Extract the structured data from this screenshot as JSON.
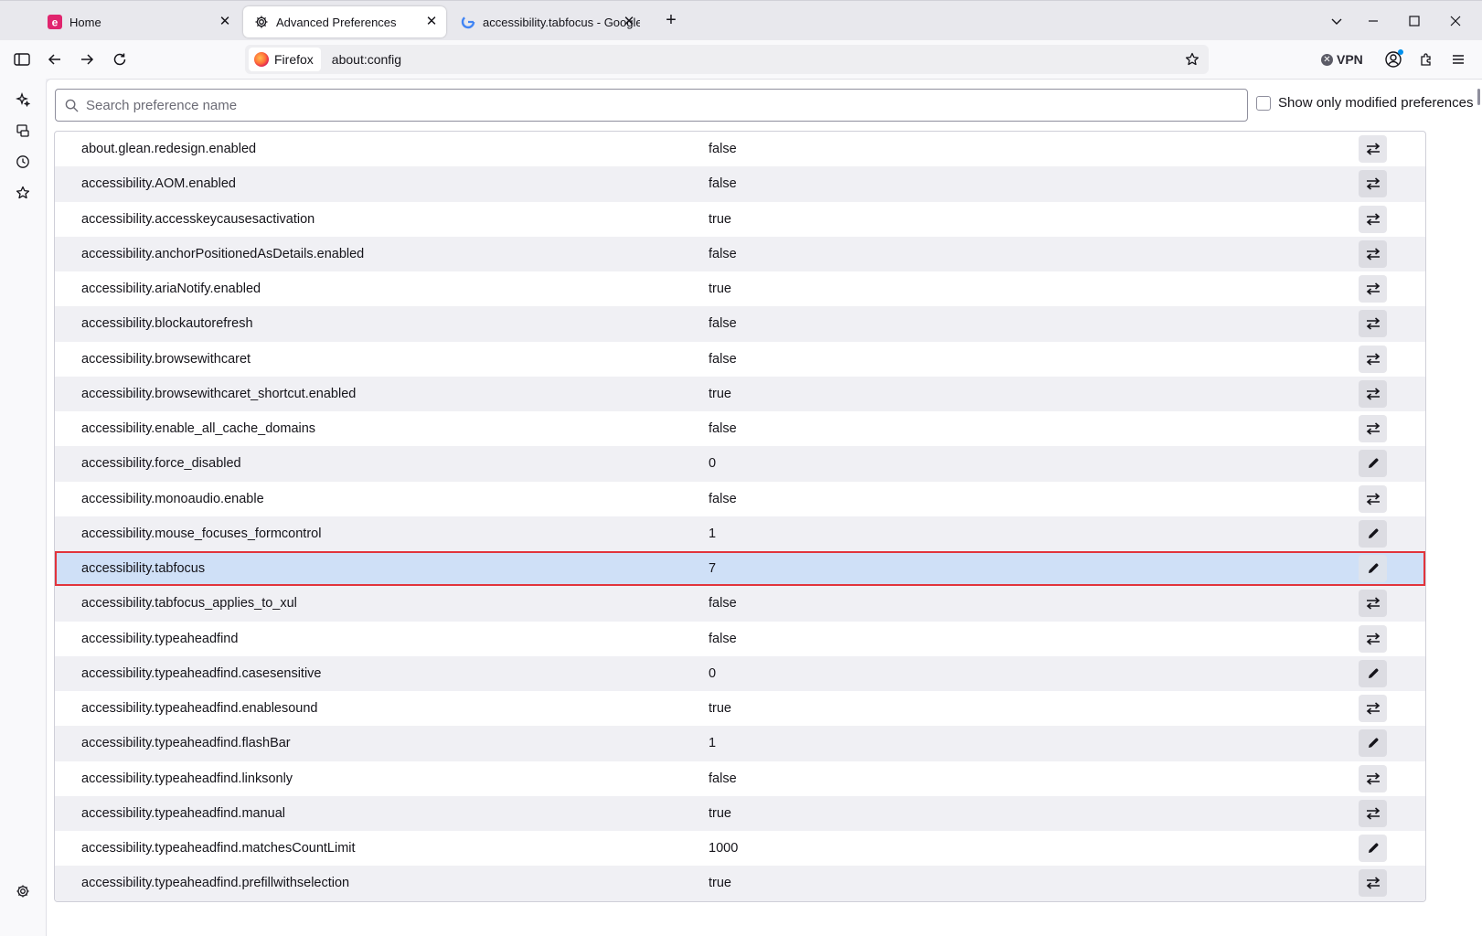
{
  "tabs": [
    {
      "title": "Home",
      "icon": "e-app-icon"
    },
    {
      "title": "Advanced Preferences",
      "icon": "gear-icon"
    },
    {
      "title": "accessibility.tabfocus - Google S",
      "icon": "google-icon"
    }
  ],
  "urlbar": {
    "identity": "Firefox",
    "url": "about:config"
  },
  "toolbar": {
    "vpn_label": "VPN"
  },
  "config": {
    "search_placeholder": "Search preference name",
    "modified_only_label": "Show only modified preferences",
    "prefs": [
      {
        "name": "about.glean.redesign.enabled",
        "value": "false",
        "action": "toggle"
      },
      {
        "name": "accessibility.AOM.enabled",
        "value": "false",
        "action": "toggle"
      },
      {
        "name": "accessibility.accesskeycausesactivation",
        "value": "true",
        "action": "toggle"
      },
      {
        "name": "accessibility.anchorPositionedAsDetails.enabled",
        "value": "false",
        "action": "toggle"
      },
      {
        "name": "accessibility.ariaNotify.enabled",
        "value": "true",
        "action": "toggle"
      },
      {
        "name": "accessibility.blockautorefresh",
        "value": "false",
        "action": "toggle"
      },
      {
        "name": "accessibility.browsewithcaret",
        "value": "false",
        "action": "toggle"
      },
      {
        "name": "accessibility.browsewithcaret_shortcut.enabled",
        "value": "true",
        "action": "toggle"
      },
      {
        "name": "accessibility.enable_all_cache_domains",
        "value": "false",
        "action": "toggle"
      },
      {
        "name": "accessibility.force_disabled",
        "value": "0",
        "action": "edit"
      },
      {
        "name": "accessibility.monoaudio.enable",
        "value": "false",
        "action": "toggle"
      },
      {
        "name": "accessibility.mouse_focuses_formcontrol",
        "value": "1",
        "action": "edit"
      },
      {
        "name": "accessibility.tabfocus",
        "value": "7",
        "action": "edit",
        "selected": true
      },
      {
        "name": "accessibility.tabfocus_applies_to_xul",
        "value": "false",
        "action": "toggle"
      },
      {
        "name": "accessibility.typeaheadfind",
        "value": "false",
        "action": "toggle"
      },
      {
        "name": "accessibility.typeaheadfind.casesensitive",
        "value": "0",
        "action": "edit"
      },
      {
        "name": "accessibility.typeaheadfind.enablesound",
        "value": "true",
        "action": "toggle"
      },
      {
        "name": "accessibility.typeaheadfind.flashBar",
        "value": "1",
        "action": "edit"
      },
      {
        "name": "accessibility.typeaheadfind.linksonly",
        "value": "false",
        "action": "toggle"
      },
      {
        "name": "accessibility.typeaheadfind.manual",
        "value": "true",
        "action": "toggle"
      },
      {
        "name": "accessibility.typeaheadfind.matchesCountLimit",
        "value": "1000",
        "action": "edit"
      },
      {
        "name": "accessibility.typeaheadfind.prefillwithselection",
        "value": "true",
        "action": "toggle"
      }
    ]
  },
  "colors": {
    "selected_row": "#cfe0f7",
    "highlight_border": "#e2343c",
    "accent": "#0061e0"
  }
}
